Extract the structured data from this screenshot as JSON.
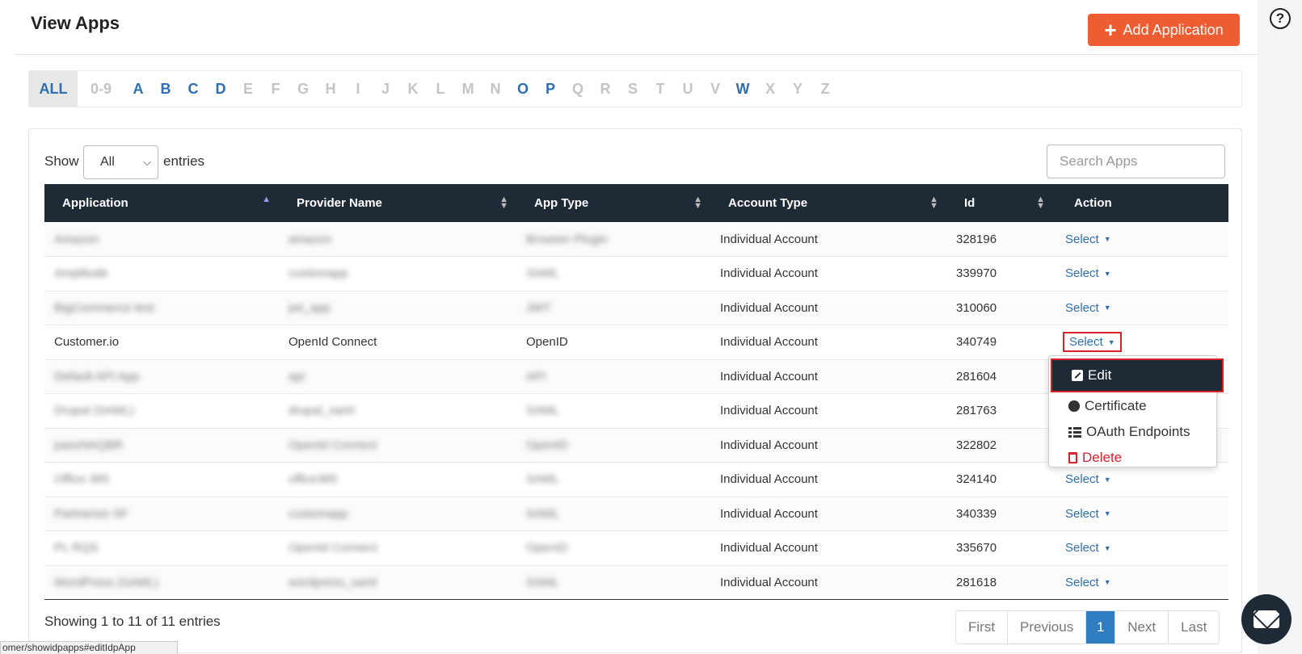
{
  "header": {
    "title": "View Apps",
    "add_button": "Add Application",
    "help": "?"
  },
  "alpha_filter": [
    {
      "label": "ALL",
      "active": true,
      "all": true
    },
    {
      "label": "0-9",
      "active": false,
      "num": true
    },
    {
      "label": "A",
      "active": true
    },
    {
      "label": "B",
      "active": true
    },
    {
      "label": "C",
      "active": true
    },
    {
      "label": "D",
      "active": true
    },
    {
      "label": "E",
      "active": false
    },
    {
      "label": "F",
      "active": false
    },
    {
      "label": "G",
      "active": false
    },
    {
      "label": "H",
      "active": false
    },
    {
      "label": "I",
      "active": false
    },
    {
      "label": "J",
      "active": false
    },
    {
      "label": "K",
      "active": false
    },
    {
      "label": "L",
      "active": false
    },
    {
      "label": "M",
      "active": false
    },
    {
      "label": "N",
      "active": false
    },
    {
      "label": "O",
      "active": true
    },
    {
      "label": "P",
      "active": true
    },
    {
      "label": "Q",
      "active": false
    },
    {
      "label": "R",
      "active": false
    },
    {
      "label": "S",
      "active": false
    },
    {
      "label": "T",
      "active": false
    },
    {
      "label": "U",
      "active": false
    },
    {
      "label": "V",
      "active": false
    },
    {
      "label": "W",
      "active": true
    },
    {
      "label": "X",
      "active": false
    },
    {
      "label": "Y",
      "active": false
    },
    {
      "label": "Z",
      "active": false
    }
  ],
  "controls": {
    "show": "Show",
    "entries_value": "All",
    "entries": "entries",
    "search_placeholder": "Search Apps"
  },
  "table": {
    "columns": [
      "Application",
      "Provider Name",
      "App Type",
      "Account Type",
      "Id",
      "Action"
    ],
    "rows": [
      {
        "app": "Amazon",
        "provider": "amazon",
        "type": "Browser Plugin",
        "account": "Individual Account",
        "id": "328196",
        "blurred": true
      },
      {
        "app": "Amplitude",
        "provider": "customapp",
        "type": "SAML",
        "account": "Individual Account",
        "id": "339970",
        "blurred": true
      },
      {
        "app": "BigCommerce test",
        "provider": "jwt_app",
        "type": "JWT",
        "account": "Individual Account",
        "id": "310060",
        "blurred": true
      },
      {
        "app": "Customer.io",
        "provider": "OpenId Connect",
        "type": "OpenID",
        "account": "Individual Account",
        "id": "340749",
        "blurred": false
      },
      {
        "app": "Default API App",
        "provider": "api",
        "type": "API",
        "account": "Individual Account",
        "id": "281604",
        "blurred": true
      },
      {
        "app": "Drupal (SAML)",
        "provider": "drupal_saml",
        "type": "SAML",
        "account": "Individual Account",
        "id": "281763",
        "blurred": true
      },
      {
        "app": "passNAQBR",
        "provider": "OpenId Connect",
        "type": "OpenID",
        "account": "Individual Account",
        "id": "322802",
        "blurred": true
      },
      {
        "app": "Office 365",
        "provider": "office365",
        "type": "SAML",
        "account": "Individual Account",
        "id": "324140",
        "blurred": true
      },
      {
        "app": "Partnerize SF",
        "provider": "customapp",
        "type": "SAML",
        "account": "Individual Account",
        "id": "340339",
        "blurred": true
      },
      {
        "app": "PL RQS",
        "provider": "OpenId Connect",
        "type": "OpenID",
        "account": "Individual Account",
        "id": "335670",
        "blurred": true
      },
      {
        "app": "WordPress (SAML)",
        "provider": "wordpress_saml",
        "type": "SAML",
        "account": "Individual Account",
        "id": "281618",
        "blurred": true
      }
    ],
    "action_label": "Select"
  },
  "dropdown": {
    "edit": "Edit",
    "certificate": "Certificate",
    "oauth": "OAuth Endpoints",
    "delete": "Delete"
  },
  "footer": {
    "info": "Showing 1 to 11 of 11 entries",
    "pages": [
      "First",
      "Previous",
      "1",
      "Next",
      "Last"
    ],
    "current_page": "1",
    "status_url": "omer/showidpapps#editIdpApp"
  },
  "colors": {
    "accent": "#ee5c32",
    "header_bg": "#1f2a37",
    "link": "#2f6fb0",
    "danger": "#d9212c"
  }
}
